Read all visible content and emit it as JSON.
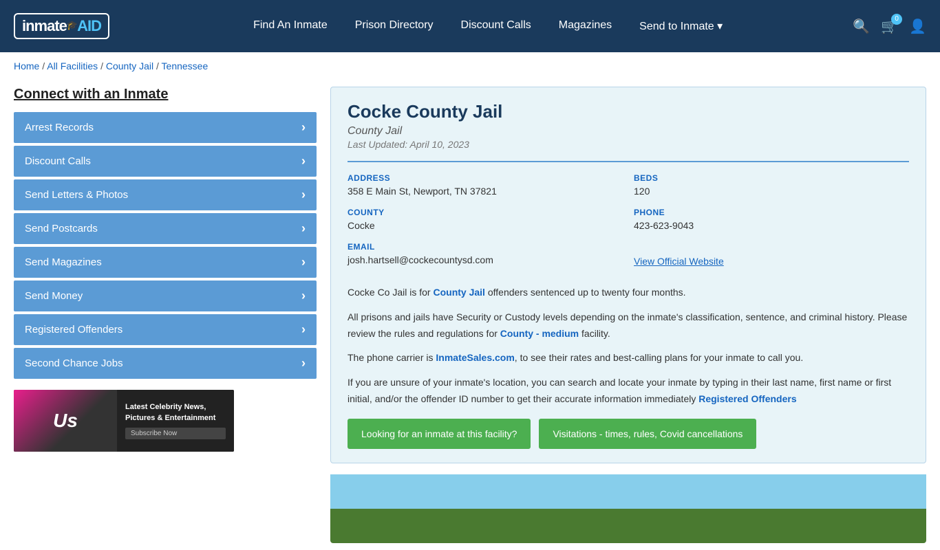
{
  "header": {
    "logo_text": "inmate",
    "logo_aid": "AID",
    "nav": [
      {
        "label": "Find An Inmate",
        "id": "find-inmate"
      },
      {
        "label": "Prison Directory",
        "id": "prison-directory"
      },
      {
        "label": "Discount Calls",
        "id": "discount-calls"
      },
      {
        "label": "Magazines",
        "id": "magazines"
      },
      {
        "label": "Send to Inmate ▾",
        "id": "send-to-inmate"
      }
    ],
    "cart_count": "0"
  },
  "breadcrumb": {
    "home": "Home",
    "sep1": " / ",
    "all_facilities": "All Facilities",
    "sep2": " / ",
    "county_jail": "County Jail",
    "sep3": " / ",
    "state": "Tennessee"
  },
  "sidebar": {
    "title": "Connect with an Inmate",
    "menu": [
      {
        "label": "Arrest Records"
      },
      {
        "label": "Discount Calls"
      },
      {
        "label": "Send Letters & Photos"
      },
      {
        "label": "Send Postcards"
      },
      {
        "label": "Send Magazines"
      },
      {
        "label": "Send Money"
      },
      {
        "label": "Registered Offenders"
      },
      {
        "label": "Second Chance Jobs"
      }
    ],
    "ad": {
      "logo": "Us",
      "title": "Latest Celebrity News, Pictures & Entertainment",
      "button": "Subscribe Now"
    }
  },
  "facility": {
    "name": "Cocke County Jail",
    "type": "County Jail",
    "last_updated": "Last Updated: April 10, 2023",
    "address_label": "ADDRESS",
    "address_value": "358 E Main St, Newport, TN 37821",
    "beds_label": "BEDS",
    "beds_value": "120",
    "county_label": "COUNTY",
    "county_value": "Cocke",
    "phone_label": "PHONE",
    "phone_value": "423-623-9043",
    "email_label": "EMAIL",
    "email_value": "josh.hartsell@cockecountysd.com",
    "website_link": "View Official Website",
    "desc1": "Cocke Co Jail is for County Jail offenders sentenced up to twenty four months.",
    "desc2": "All prisons and jails have Security or Custody levels depending on the inmate's classification, sentence, and criminal history. Please review the rules and regulations for County - medium facility.",
    "desc3": "The phone carrier is InmateSales.com, to see their rates and best-calling plans for your inmate to call you.",
    "desc4": "If you are unsure of your inmate's location, you can search and locate your inmate by typing in their last name, first name or first initial, and/or the offender ID number to get their accurate information immediately Registered Offenders",
    "btn1": "Looking for an inmate at this facility?",
    "btn2": "Visitations - times, rules, Covid cancellations"
  }
}
